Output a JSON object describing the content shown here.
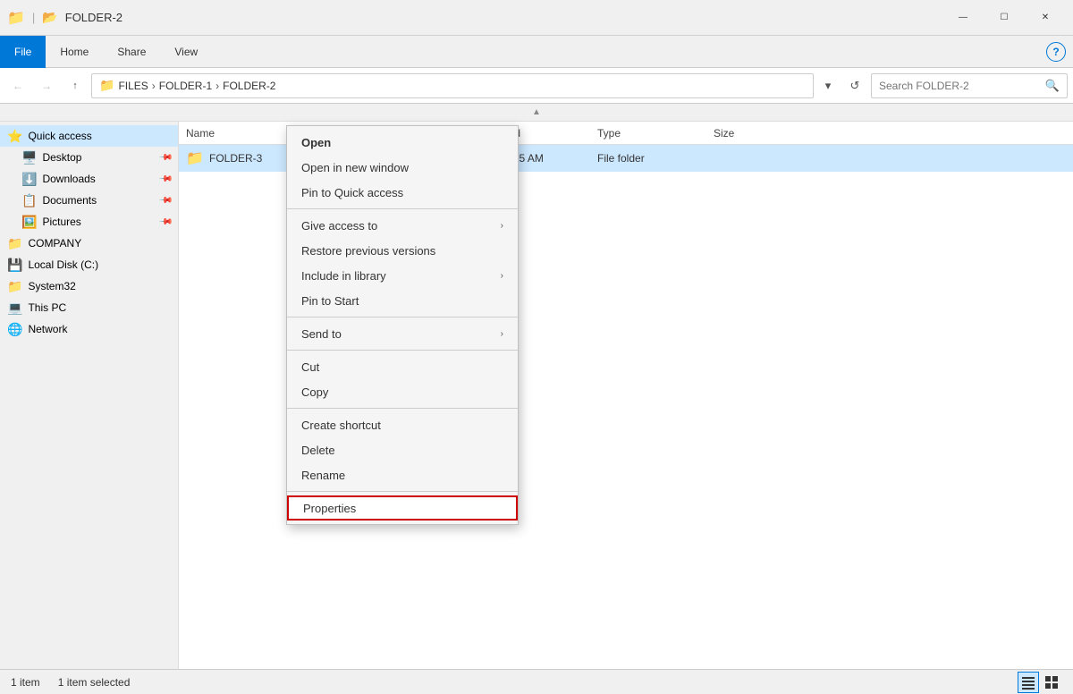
{
  "titleBar": {
    "title": "FOLDER-2",
    "windowControls": {
      "minimize": "—",
      "maximize": "☐",
      "close": "✕"
    }
  },
  "ribbon": {
    "tabs": [
      "File",
      "Home",
      "Share",
      "View"
    ],
    "activeTab": "File",
    "helpIcon": "?"
  },
  "addressBar": {
    "back": "←",
    "forward": "→",
    "up": "↑",
    "pathParts": [
      "FILES",
      "FOLDER-1",
      "FOLDER-2"
    ],
    "searchPlaceholder": "Search FOLDER-2",
    "refreshIcon": "↺"
  },
  "columnHeaders": {
    "name": "Name",
    "dateModified": "Date modified",
    "type": "Type",
    "size": "Size"
  },
  "sidebar": {
    "quickAccess": {
      "label": "Quick access",
      "items": [
        {
          "label": "Desktop",
          "pinned": true,
          "icon": "desktop"
        },
        {
          "label": "Downloads",
          "pinned": true,
          "icon": "downloads"
        },
        {
          "label": "Documents",
          "pinned": true,
          "icon": "documents"
        },
        {
          "label": "Pictures",
          "pinned": true,
          "icon": "pictures"
        }
      ]
    },
    "items": [
      {
        "label": "COMPANY",
        "icon": "folder"
      },
      {
        "label": "Local Disk (C:)",
        "icon": "disk"
      },
      {
        "label": "System32",
        "icon": "folder"
      }
    ],
    "thisPC": {
      "label": "This PC",
      "icon": "thispc"
    },
    "network": {
      "label": "Network",
      "icon": "network"
    }
  },
  "fileList": {
    "files": [
      {
        "name": "FOLDER-3",
        "dateModified": "6/5/2020 11:35 AM",
        "type": "File folder",
        "size": "",
        "selected": true
      }
    ]
  },
  "contextMenu": {
    "items": [
      {
        "label": "Open",
        "bold": true,
        "separator_after": false
      },
      {
        "label": "Open in new window",
        "separator_after": false
      },
      {
        "label": "Pin to Quick access",
        "separator_after": true
      },
      {
        "label": "Give access to",
        "hasArrow": true,
        "separator_after": false
      },
      {
        "label": "Restore previous versions",
        "separator_after": false
      },
      {
        "label": "Include in library",
        "hasArrow": true,
        "separator_after": false
      },
      {
        "label": "Pin to Start",
        "separator_after": true
      },
      {
        "label": "Send to",
        "hasArrow": true,
        "separator_after": true
      },
      {
        "label": "Cut",
        "separator_after": false
      },
      {
        "label": "Copy",
        "separator_after": true
      },
      {
        "label": "Create shortcut",
        "separator_after": false
      },
      {
        "label": "Delete",
        "separator_after": false
      },
      {
        "label": "Rename",
        "separator_after": true
      },
      {
        "label": "Properties",
        "highlighted": true,
        "separator_after": false
      }
    ]
  },
  "statusBar": {
    "itemCount": "1 item",
    "selectedCount": "1 item selected"
  }
}
